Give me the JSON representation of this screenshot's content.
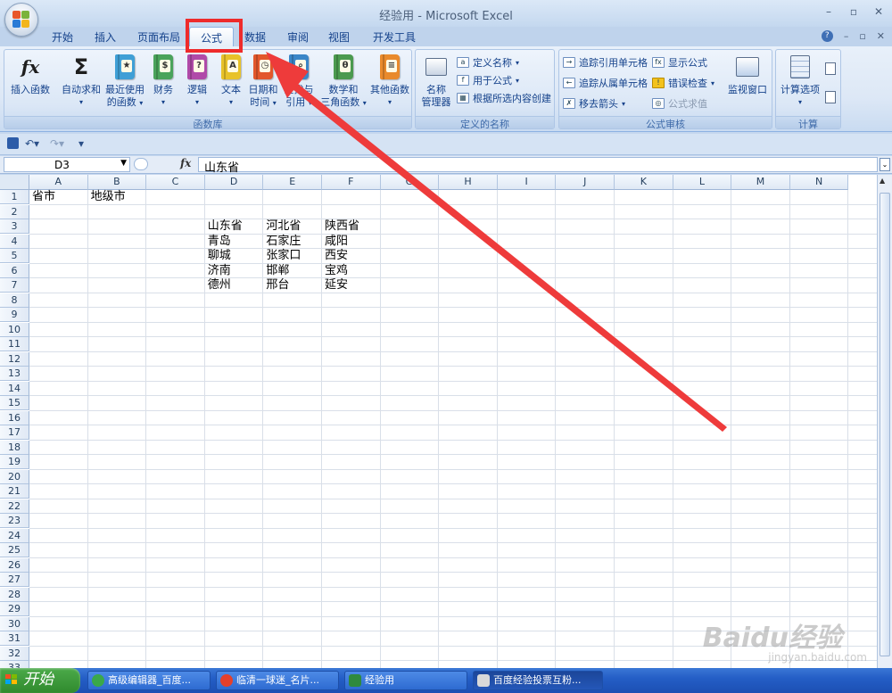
{
  "window": {
    "title": "经验用 - Microsoft Excel"
  },
  "tabs": [
    "开始",
    "插入",
    "页面布局",
    "公式",
    "数据",
    "审阅",
    "视图",
    "开发工具"
  ],
  "active_tab": "公式",
  "ribbon": {
    "function_library": {
      "label": "函数库",
      "insert_function": "插入函数",
      "autosum": "自动求和",
      "recent_line1": "最近使用",
      "recent_line2": "的函数",
      "finance": "财务",
      "logic": "逻辑",
      "text": "文本",
      "datetime_line1": "日期和",
      "datetime_line2": "时间",
      "lookup_line1": "查找与",
      "lookup_line2": "引用",
      "math_line1": "数学和",
      "math_line2": "三角函数",
      "more": "其他函数"
    },
    "defined_names": {
      "label": "定义的名称",
      "name_manager_line1": "名称",
      "name_manager_line2": "管理器",
      "define_name": "定义名称",
      "use_in_formula": "用于公式",
      "create_from_selection": "根据所选内容创建"
    },
    "formula_auditing": {
      "label": "公式审核",
      "trace_precedents": "追踪引用单元格",
      "trace_dependents": "追踪从属单元格",
      "remove_arrows": "移去箭头",
      "show_formulas": "显示公式",
      "error_checking": "错误检查",
      "evaluate_formula": "公式求值",
      "watch_window": "监视窗口"
    },
    "calculation": {
      "label": "计算",
      "calc_options": "计算选项"
    }
  },
  "formula_bar": {
    "name_box": "D3",
    "fx": "fx",
    "content": "山东省"
  },
  "sheet": {
    "columns": [
      "A",
      "B",
      "C",
      "D",
      "E",
      "F",
      "G",
      "H",
      "I",
      "J",
      "K",
      "L",
      "M",
      "N"
    ],
    "rows": [
      "1",
      "2",
      "3",
      "4",
      "5",
      "6",
      "7",
      "8",
      "9",
      "10",
      "11",
      "12",
      "13",
      "14",
      "15",
      "16",
      "17",
      "18",
      "19",
      "20",
      "21",
      "22",
      "23",
      "24",
      "25",
      "26",
      "27",
      "28",
      "29",
      "30",
      "31",
      "32",
      "33"
    ],
    "cells": {
      "A1": "省市",
      "B1": "地级市",
      "D3": "山东省",
      "E3": "河北省",
      "F3": "陕西省",
      "D4": "青岛",
      "E4": "石家庄",
      "F4": "咸阳",
      "D5": "聊城",
      "E5": "张家口",
      "F5": "西安",
      "D6": "济南",
      "E6": "邯郸",
      "F6": "宝鸡",
      "D7": "德州",
      "E7": "邢台",
      "F7": "延安"
    }
  },
  "taskbar": {
    "start": "开始",
    "items": [
      "高级编辑器_百度...",
      "临清一球迷_名片...",
      "经验用",
      "百度经验投票互粉..."
    ]
  },
  "watermark": {
    "brand": "Baidu经验",
    "url": "jingyan.baidu.com"
  },
  "colors": {
    "highlight": "#ee2b2b",
    "accent": "#15428b"
  }
}
